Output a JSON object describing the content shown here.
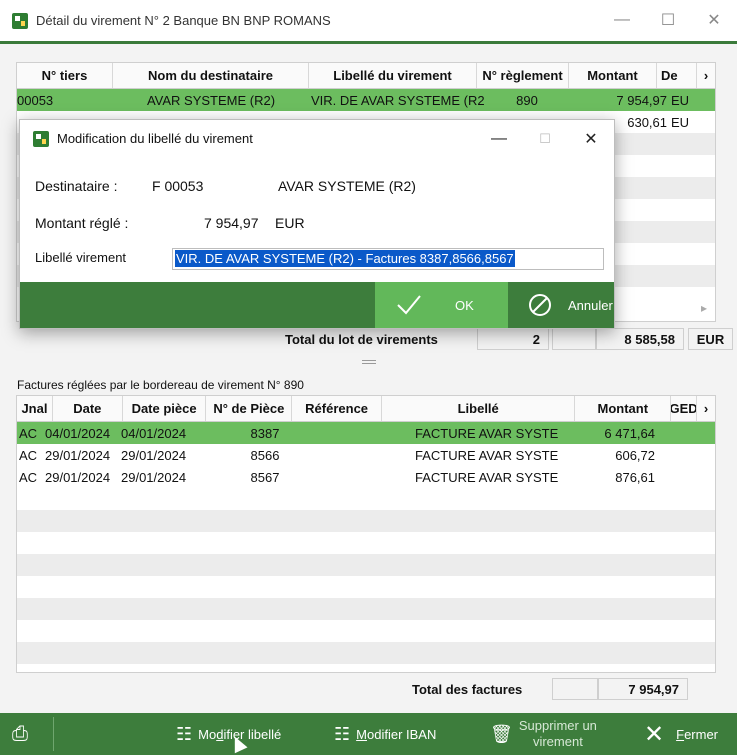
{
  "window": {
    "title": "Détail du virement N° 2 Banque BN BNP ROMANS",
    "controls": {
      "minimize": "—",
      "maximize": "☐",
      "close": "✕"
    }
  },
  "top_table": {
    "columns": [
      "N° tiers",
      "Nom du destinataire",
      "Libellé du virement",
      "N° règlement",
      "Montant",
      "De"
    ],
    "rows": [
      {
        "tiers": "00053",
        "nom": "AVAR SYSTEME (R2)",
        "libelle": "VIR. DE AVAR SYSTEME (R2",
        "reglement": "890",
        "montant": "7 954,97",
        "devise": "EU"
      },
      {
        "tiers": "",
        "nom": "",
        "libelle": "",
        "reglement": "",
        "montant": "630,61",
        "devise": "EU"
      }
    ],
    "total_label": "Total du lot de virements",
    "total_count": "2",
    "total_amount": "8 585,58",
    "total_currency": "EUR"
  },
  "section_label": "Factures réglées par le bordereau de virement N° 890",
  "bottom_table": {
    "columns": [
      "Jnal",
      "Date",
      "Date pièce",
      "N° de Pièce",
      "Référence",
      "Libellé",
      "Montant",
      "GED"
    ],
    "rows": [
      {
        "jnal": "AC",
        "date": "04/01/2024",
        "date_piece": "04/01/2024",
        "piece": "8387",
        "ref": "",
        "libelle": "FACTURE AVAR SYSTE",
        "montant": "6 471,64"
      },
      {
        "jnal": "AC",
        "date": "29/01/2024",
        "date_piece": "29/01/2024",
        "piece": "8566",
        "ref": "",
        "libelle": "FACTURE AVAR SYSTE",
        "montant": "606,72"
      },
      {
        "jnal": "AC",
        "date": "29/01/2024",
        "date_piece": "29/01/2024",
        "piece": "8567",
        "ref": "",
        "libelle": "FACTURE AVAR SYSTE",
        "montant": "876,61"
      }
    ],
    "total_label": "Total des factures",
    "total_amount": "7 954,97"
  },
  "toolbar": {
    "modifier_libelle": {
      "prefix": "Mo",
      "accel": "d",
      "suffix": "ifier libellé"
    },
    "modifier_iban": {
      "accel": "M",
      "suffix": "odifier IBAN"
    },
    "supprimer_line1": "Supprimer un",
    "supprimer_line2": "virement",
    "fermer": {
      "accel": "F",
      "suffix": "ermer"
    }
  },
  "modal": {
    "title": "Modification du libellé du virement",
    "destinataire_label": "Destinataire :",
    "destinataire_code": "F 00053",
    "destinataire_nom": "AVAR SYSTEME (R2)",
    "montant_label": "Montant réglé :",
    "montant_value": "7 954,97",
    "montant_currency": "EUR",
    "libelle_label": "Libellé virement",
    "libelle_value": "VIR. DE AVAR SYSTEME (R2) - Factures 8387,8566,8567",
    "ok_label": "OK",
    "cancel_label": "Annuler"
  },
  "colors": {
    "brand_green": "#3d7d3c",
    "row_selected": "#6cbd5f",
    "selection_blue": "#0a59c9"
  }
}
